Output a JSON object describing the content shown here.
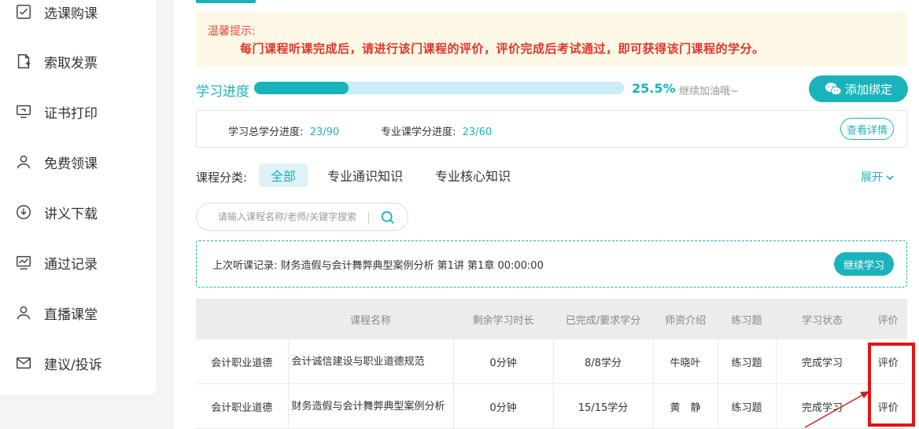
{
  "sidebar": {
    "items": [
      {
        "label": "选课购课",
        "icon": "checkbox-icon"
      },
      {
        "label": "索取发票",
        "icon": "invoice-icon"
      },
      {
        "label": "证书打印",
        "icon": "monitor-icon"
      },
      {
        "label": "免费领课",
        "icon": "user-icon"
      },
      {
        "label": "讲义下载",
        "icon": "download-icon"
      },
      {
        "label": "通过记录",
        "icon": "chart-icon"
      },
      {
        "label": "直播课堂",
        "icon": "user-icon"
      },
      {
        "label": "建议/投诉",
        "icon": "mail-icon"
      }
    ]
  },
  "notice": {
    "title": "温馨提示:",
    "text": "每门课程听课完成后，请进行该门课程的评价，评价完成后考试通过，即可获得该门课程的学分。"
  },
  "progress": {
    "label": "学习进度",
    "percent_text": "25.5%",
    "fraction": 0.255,
    "tip": "继续加油哦~",
    "bind_button": "添加绑定"
  },
  "credits": {
    "total_label": "学习总学分进度:",
    "total_value": "23/90",
    "major_label": "专业课学分进度:",
    "major_value": "23/60",
    "detail_button": "查看详情"
  },
  "categories": {
    "label": "课程分类:",
    "tabs": [
      "全部",
      "专业通识知识",
      "专业核心知识"
    ],
    "expand": "展开"
  },
  "search": {
    "placeholder": "请输入课程名称/老师/关键字搜索"
  },
  "last_record": {
    "text": "上次听课记录: 财务造假与会计舞弊典型案例分析 第1讲 第1章 00:00:00",
    "button": "继续学习"
  },
  "table": {
    "headers": [
      "",
      "课程名称",
      "剩余学习时长",
      "已完成/要求学分",
      "师资介绍",
      "练习题",
      "学习状态",
      "评价"
    ],
    "rows": [
      [
        "会计职业道德",
        "会计诚信建设与职业道德规范",
        "0分钟",
        "8/8学分",
        "牛晓叶",
        "练习题",
        "完成学习",
        "评价"
      ],
      [
        "会计职业道德",
        "财务造假与会计舞弊典型案例分析",
        "0分钟",
        "15/15学分",
        "黄　静",
        "练习题",
        "完成学习",
        "评价"
      ]
    ]
  },
  "colors": {
    "accent": "#1ab3bc",
    "notice_bg": "#fff8e6",
    "notice_text": "#e0352b",
    "highlight_box": "#e31414"
  }
}
